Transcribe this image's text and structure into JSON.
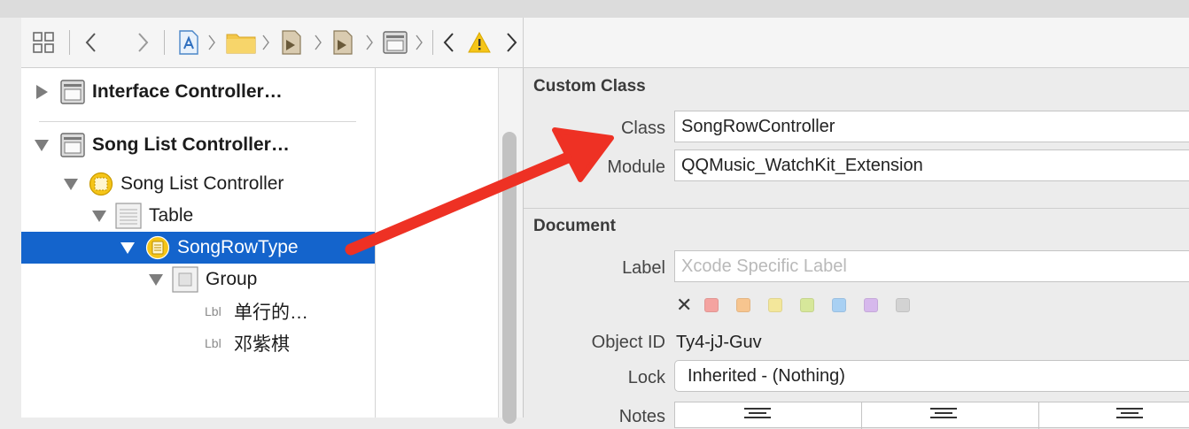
{
  "jumpbar": {
    "icons": [
      "grid-icon",
      "back-chevron-icon",
      "forward-chevron-icon",
      "app-file-icon",
      "folder-icon",
      "storyboard-icon",
      "storyboard-icon",
      "controller-scene-icon",
      "prev-issue-chevron-icon",
      "warning-icon",
      "next-issue-chevron-icon"
    ]
  },
  "outline": {
    "items": [
      {
        "label": "Interface Controller…",
        "icon": "scene-icon",
        "expanded": false,
        "bold": true
      },
      {
        "label": "Song List Controller…",
        "icon": "scene-icon",
        "expanded": true,
        "bold": true
      },
      {
        "label": "Song List Controller",
        "icon": "controller-icon",
        "expanded": true,
        "bold": false
      },
      {
        "label": "Table",
        "icon": "table-icon",
        "expanded": true,
        "bold": false
      },
      {
        "label": "SongRowType",
        "icon": "row-controller-icon",
        "expanded": true,
        "bold": false,
        "selected": true
      },
      {
        "label": "Group",
        "icon": "group-icon",
        "expanded": true,
        "bold": false
      },
      {
        "tag": "Lbl",
        "label": "单行的…"
      },
      {
        "tag": "Lbl",
        "label": "邓紫棋"
      }
    ]
  },
  "inspector": {
    "custom_class": {
      "title": "Custom Class",
      "class_label": "Class",
      "class_value": "SongRowController",
      "module_label": "Module",
      "module_value": "QQMusic_WatchKit_Extension"
    },
    "document": {
      "title": "Document",
      "label_label": "Label",
      "label_placeholder": "Xcode Specific Label",
      "label_colors": [
        "#f4a3a0",
        "#f7c58f",
        "#f3e79b",
        "#d6e79a",
        "#a8d0f3",
        "#d6b8ec",
        "#d3d3d3"
      ],
      "object_id_label": "Object ID",
      "object_id_value": "Ty4-jJ-Guv",
      "lock_label": "Lock",
      "lock_value": "Inherited - (Nothing)",
      "notes_label": "Notes"
    }
  },
  "colors": {
    "selection": "#1464cc",
    "annotation_arrow": "#ee3124"
  }
}
